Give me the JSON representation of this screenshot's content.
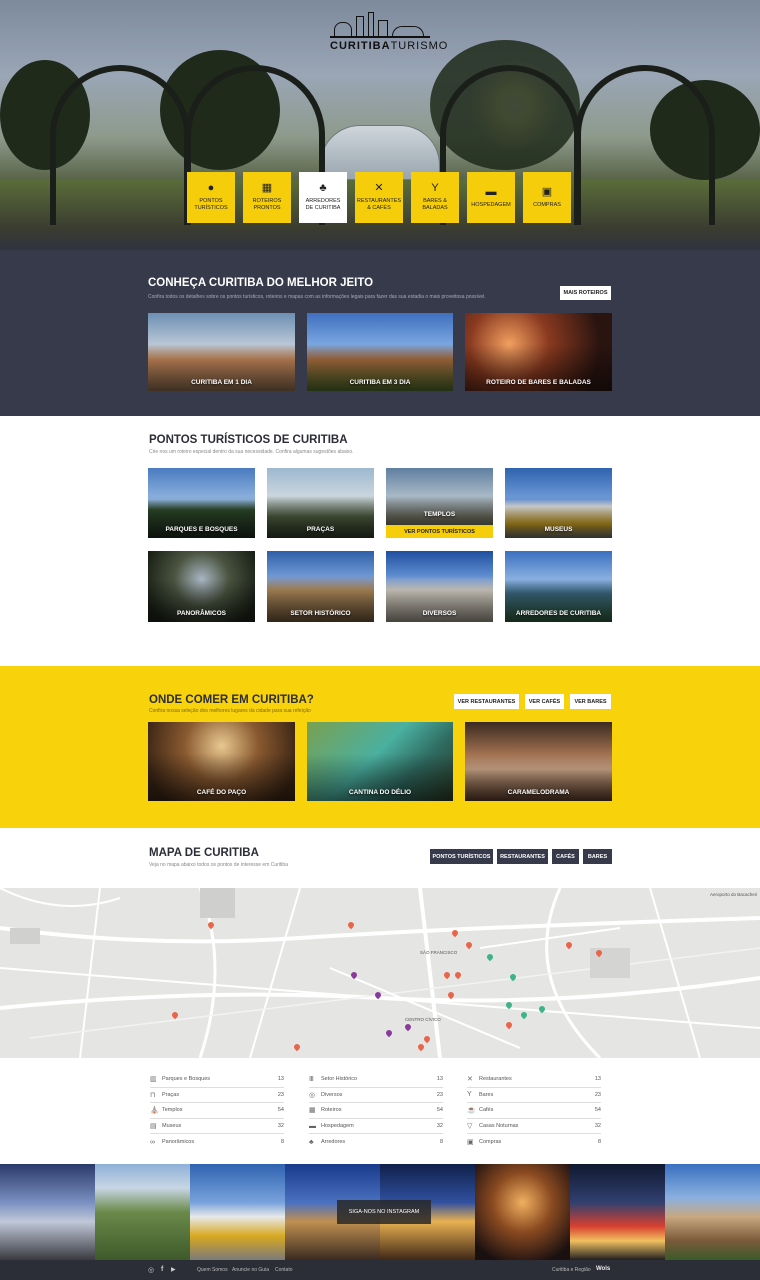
{
  "header": {
    "logo_brand_bold": "CURITIBA",
    "logo_brand_light": "TURISMO",
    "categories": [
      {
        "icon": "map-pin-icon",
        "glyph": "⬤",
        "line1": "PONTOS",
        "line2": "TURÍSTICOS"
      },
      {
        "icon": "map-icon",
        "glyph": "▦",
        "line1": "ROTEIROS",
        "line2": "PRONTOS"
      },
      {
        "icon": "tree-icon",
        "glyph": "♣",
        "line1": "ARREDORES",
        "line2": "DE CURITIBA"
      },
      {
        "icon": "cutlery-icon",
        "glyph": "✕",
        "line1": "RESTAURANTES",
        "line2": "& CAFÉS"
      },
      {
        "icon": "cocktail-icon",
        "glyph": "Y",
        "line1": "BARES &",
        "line2": "BALADAS"
      },
      {
        "icon": "bed-icon",
        "glyph": "▬",
        "line1": "HOSPEDAGEM",
        "line2": ""
      },
      {
        "icon": "shopping-bag-icon",
        "glyph": "▣",
        "line1": "COMPRAS",
        "line2": ""
      }
    ]
  },
  "conheca": {
    "title": "CONHEÇA CURITIBA DO MELHOR JEITO",
    "subtitle": "Confira todos os detalhes sobre os pontos turísticos, roteiros e mapas com as informações legais para fazer das sua estadia o mais proveitosa possível.",
    "button": "MAIS ROTEIROS",
    "cards": [
      "CURITIBA EM 1 DIA",
      "CURITIBA EM 3 DIA",
      "ROTEIRO DE BARES E BALADAS"
    ]
  },
  "pontos": {
    "title": "PONTOS TURÍSTICOS DE CURITIBA",
    "subtitle": "Crie nos um roteiro especial dentro da sua necessidade. Confira algumas sugestões abaixo.",
    "cards": [
      "PARQUES E BOSQUES",
      "PRAÇAS",
      "TEMPLOS",
      "MUSEUS",
      "PANORÂMICOS",
      "SETOR HISTÓRICO",
      "DIVERSOS",
      "ARREDORES DE CURITIBA"
    ],
    "hover_button": "VER PONTOS TURÍSTICOS"
  },
  "comer": {
    "title": "ONDE COMER EM CURITIBA?",
    "subtitle": "Confira nossa seleção dos melhores lugares da cidade para sua refeição",
    "buttons": [
      "VER RESTAURANTES",
      "VER CAFÉS",
      "VER BARES"
    ],
    "cards": [
      "CAFÉ DO PAÇO",
      "CANTINA DO DÉLIO",
      "CARAMELODRAMA"
    ]
  },
  "mapa": {
    "title": "MAPA DE CURITIBA",
    "subtitle": "Veja no mapa abaixo todos os pontos de interesse em Curitiba",
    "filters": [
      "PONTOS TURÍSTICOS",
      "RESTAURANTES",
      "CAFÉS",
      "BARES"
    ],
    "map_labels": [
      "CENTRO CÍVICO",
      "Aeroporto do Bacacheri",
      "SÃO FRANCISCO"
    ]
  },
  "stats": {
    "columns": [
      [
        {
          "icon": "building-icon",
          "label": "Parques e Bosques",
          "count": "13"
        },
        {
          "icon": "bench-icon",
          "label": "Praças",
          "count": "23"
        },
        {
          "icon": "temple-icon",
          "label": "Templos",
          "count": "54"
        },
        {
          "icon": "museum-icon",
          "label": "Museus",
          "count": "32"
        },
        {
          "icon": "binoculars-icon",
          "label": "Panorâmicos",
          "count": "8"
        }
      ],
      [
        {
          "icon": "columns-icon",
          "label": "Setor Histórico",
          "count": "13"
        },
        {
          "icon": "circle-icon",
          "label": "Diversos",
          "count": "23"
        },
        {
          "icon": "map-icon",
          "label": "Roteiros",
          "count": "54"
        },
        {
          "icon": "bed-icon",
          "label": "Hospedagem",
          "count": "32"
        },
        {
          "icon": "tree-icon",
          "label": "Arredores",
          "count": "8"
        }
      ],
      [
        {
          "icon": "cutlery-icon",
          "label": "Restaurantes",
          "count": "13"
        },
        {
          "icon": "cocktail-icon",
          "label": "Bares",
          "count": "23"
        },
        {
          "icon": "coffee-icon",
          "label": "Cafés",
          "count": "54"
        },
        {
          "icon": "drink-icon",
          "label": "Casas Noturnas",
          "count": "32"
        },
        {
          "icon": "shopping-bag-icon",
          "label": "Compras",
          "count": "8"
        }
      ]
    ]
  },
  "instagram": {
    "button": "SIGA-NOS NO INSTAGRAM"
  },
  "footer": {
    "links": [
      "Quem Somos",
      "Anuncie no Guia",
      "Contato"
    ],
    "copyright": "Curitiba e Região",
    "agency": "Wols"
  }
}
